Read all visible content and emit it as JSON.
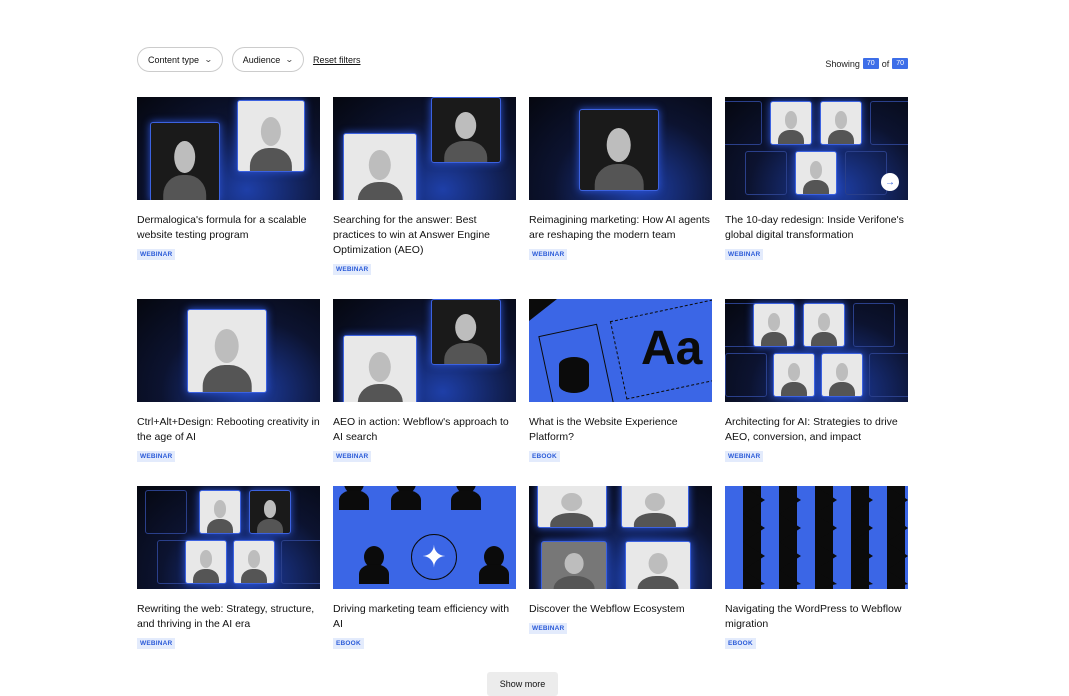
{
  "filters": {
    "content_type": "Content type",
    "audience": "Audience",
    "reset": "Reset filters"
  },
  "showing": {
    "label": "Showing",
    "count": "70",
    "of": "of",
    "total": "70"
  },
  "cards": [
    {
      "title": "Dermalogica's formula for a scalable website testing program",
      "tag": "WEBINAR"
    },
    {
      "title": "Searching for the answer: Best practices to win at Answer Engine Optimization (AEO)",
      "tag": "WEBINAR"
    },
    {
      "title": "Reimagining marketing: How AI agents are reshaping the modern team",
      "tag": "WEBINAR"
    },
    {
      "title": "The 10-day redesign: Inside Verifone's global digital transformation",
      "tag": "WEBINAR"
    },
    {
      "title": "Ctrl+Alt+Design: Rebooting creativity in the age of AI",
      "tag": "WEBINAR"
    },
    {
      "title": "AEO in action: Webflow's approach to AI search",
      "tag": "WEBINAR"
    },
    {
      "title": "What is the Website Experience Platform?",
      "tag": "EBOOK",
      "thumb_text": "Aa"
    },
    {
      "title": "Architecting for AI: Strategies to drive AEO, conversion, and impact",
      "tag": "WEBINAR"
    },
    {
      "title": "Rewriting the web: Strategy, structure, and thriving in the AI era",
      "tag": "WEBINAR"
    },
    {
      "title": "Driving marketing team efficiency with AI",
      "tag": "EBOOK"
    },
    {
      "title": "Discover the Webflow Ecosystem",
      "tag": "WEBINAR"
    },
    {
      "title": "Navigating the WordPress to Webflow migration",
      "tag": "EBOOK"
    }
  ],
  "show_more": "Show more"
}
